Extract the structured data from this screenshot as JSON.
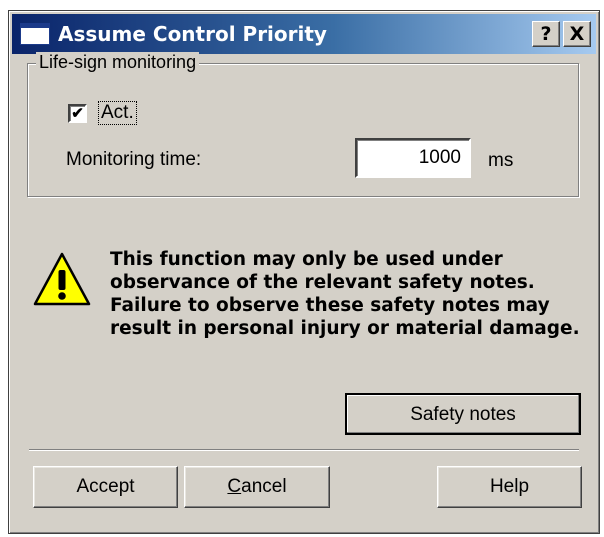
{
  "window": {
    "title": "Assume Control Priority",
    "help_button": "?",
    "close_button": "X"
  },
  "group": {
    "label": "Life-sign monitoring",
    "checkbox_label": "Act.",
    "checkbox_checked": true,
    "checkbox_mark": "✔",
    "monitoring_label": "Monitoring time:",
    "monitoring_value": "1000",
    "unit": "ms"
  },
  "warning": {
    "icon": "warning-triangle-icon",
    "text": "This function may only be used under observance of the relevant safety notes. Failure to observe these safety notes may result in personal injury or material damage."
  },
  "buttons": {
    "safety_notes": "Safety notes",
    "accept": "Accept",
    "cancel_underlined": "C",
    "cancel_rest": "ancel",
    "help": "Help"
  },
  "colors": {
    "dialog_bg": "#d4d0c8",
    "title_start": "#0a246a",
    "title_end": "#a6caf0",
    "warning_yellow": "#ffff00"
  }
}
